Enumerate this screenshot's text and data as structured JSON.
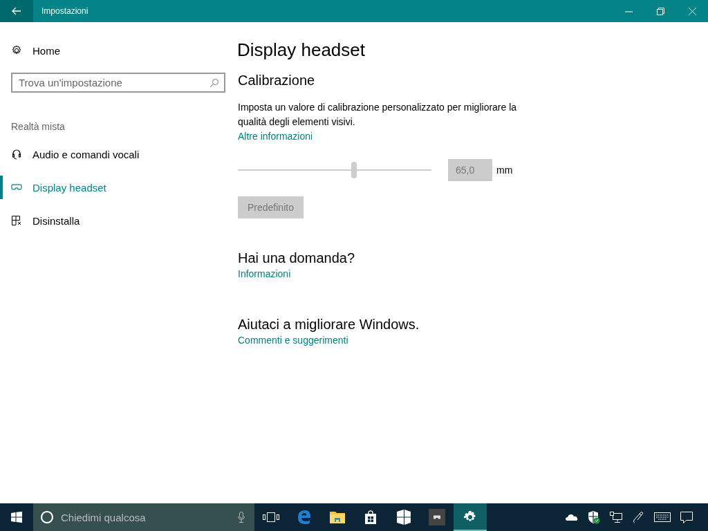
{
  "window": {
    "title": "Impostazioni"
  },
  "sidebar": {
    "home": "Home",
    "search": {
      "placeholder": "Trova un'impostazione"
    },
    "section": "Realtà mista",
    "items": [
      {
        "label": "Audio e comandi vocali",
        "kind": "headset",
        "selected": false
      },
      {
        "label": "Display headset",
        "kind": "visor",
        "selected": true
      },
      {
        "label": "Disinstalla",
        "kind": "uninstall",
        "selected": false
      }
    ]
  },
  "page": {
    "title": "Display headset",
    "calibration": {
      "heading": "Calibrazione",
      "description": "Imposta un valore di calibrazione personalizzato per migliorare la qualità degli elementi visivi.",
      "link": "Altre informazioni",
      "slider": {
        "level": 0.6,
        "disabled": true
      },
      "value": "65,0",
      "unit": "mm",
      "button": {
        "label": "Predefinito",
        "disabled": true
      }
    },
    "question": {
      "heading": "Hai una domanda?",
      "link": "Informazioni"
    },
    "feedback": {
      "heading": "Aiutaci a migliorare Windows.",
      "link": "Commenti e suggerimenti"
    }
  },
  "taskbar": {
    "search": {
      "placeholder": "Chiedimi qualcosa"
    },
    "apps": [
      {
        "kind": "taskview",
        "selected": false
      },
      {
        "kind": "browser",
        "selected": false
      },
      {
        "kind": "folder",
        "selected": false
      },
      {
        "kind": "store",
        "selected": false
      },
      {
        "kind": "tiles",
        "selected": false
      },
      {
        "kind": "app",
        "selected": false
      },
      {
        "kind": "gear",
        "selected": true
      }
    ]
  }
}
